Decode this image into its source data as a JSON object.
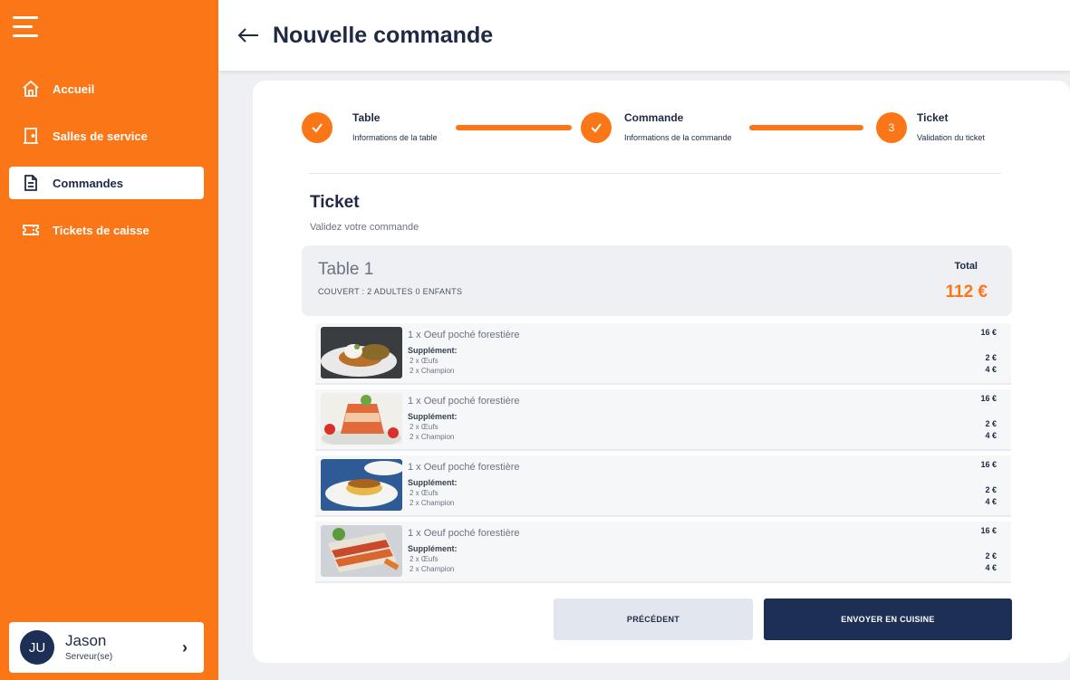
{
  "sidebar": {
    "items": [
      {
        "label": "Accueil",
        "icon": "home-icon"
      },
      {
        "label": "Salles de service",
        "icon": "door-icon"
      },
      {
        "label": "Commandes",
        "icon": "document-icon",
        "active": true
      },
      {
        "label": "Tickets de caisse",
        "icon": "ticket-icon"
      }
    ],
    "user": {
      "initials": "JU",
      "name": "Jason",
      "role": "Serveur(se)"
    }
  },
  "header": {
    "title": "Nouvelle commande"
  },
  "stepper": {
    "steps": [
      {
        "title": "Table",
        "subtitle": "Informations de la table",
        "state": "done"
      },
      {
        "title": "Commande",
        "subtitle": "Informations de la commande",
        "state": "done"
      },
      {
        "title": "Ticket",
        "subtitle": "Validation du ticket",
        "number": "3",
        "state": "current"
      }
    ]
  },
  "ticket": {
    "title": "Ticket",
    "subtitle": "Validez votre commande",
    "table_name": "Table 1",
    "covers": "COUVERT : 2 ADULTES 0 ENFANTS",
    "total_label": "Total",
    "total_value": "112 €"
  },
  "items": [
    {
      "name": "1 x Oeuf poché forestière",
      "price": "16 €",
      "supplement_label": "Supplément:",
      "supplements": [
        {
          "label": "2 x Œufs",
          "price": "2 €"
        },
        {
          "label": "2 x Champion",
          "price": "4 €"
        }
      ],
      "image": "poached-egg-dish"
    },
    {
      "name": "1 x Oeuf poché forestière",
      "price": "16 €",
      "supplement_label": "Supplément:",
      "supplements": [
        {
          "label": "2 x Œufs",
          "price": "2 €"
        },
        {
          "label": "2 x Champion",
          "price": "4 €"
        }
      ],
      "image": "aspic-terrine-dish"
    },
    {
      "name": "1 x Oeuf poché forestière",
      "price": "16 €",
      "supplement_label": "Supplément:",
      "supplements": [
        {
          "label": "2 x Œufs",
          "price": "2 €"
        },
        {
          "label": "2 x Champion",
          "price": "4 €"
        }
      ],
      "image": "flan-caramel-dish"
    },
    {
      "name": "1 x Oeuf poché forestière",
      "price": "16 €",
      "supplement_label": "Supplément:",
      "supplements": [
        {
          "label": "2 x Œufs",
          "price": "2 €"
        },
        {
          "label": "2 x Champion",
          "price": "4 €"
        }
      ],
      "image": "lasagna-dish"
    }
  ],
  "actions": {
    "previous": "PRÉCÉDENT",
    "send": "ENVOYER EN CUISINE"
  },
  "colors": {
    "accent": "#fb7617",
    "navy": "#1e2f55",
    "panel": "#eef0f4"
  }
}
